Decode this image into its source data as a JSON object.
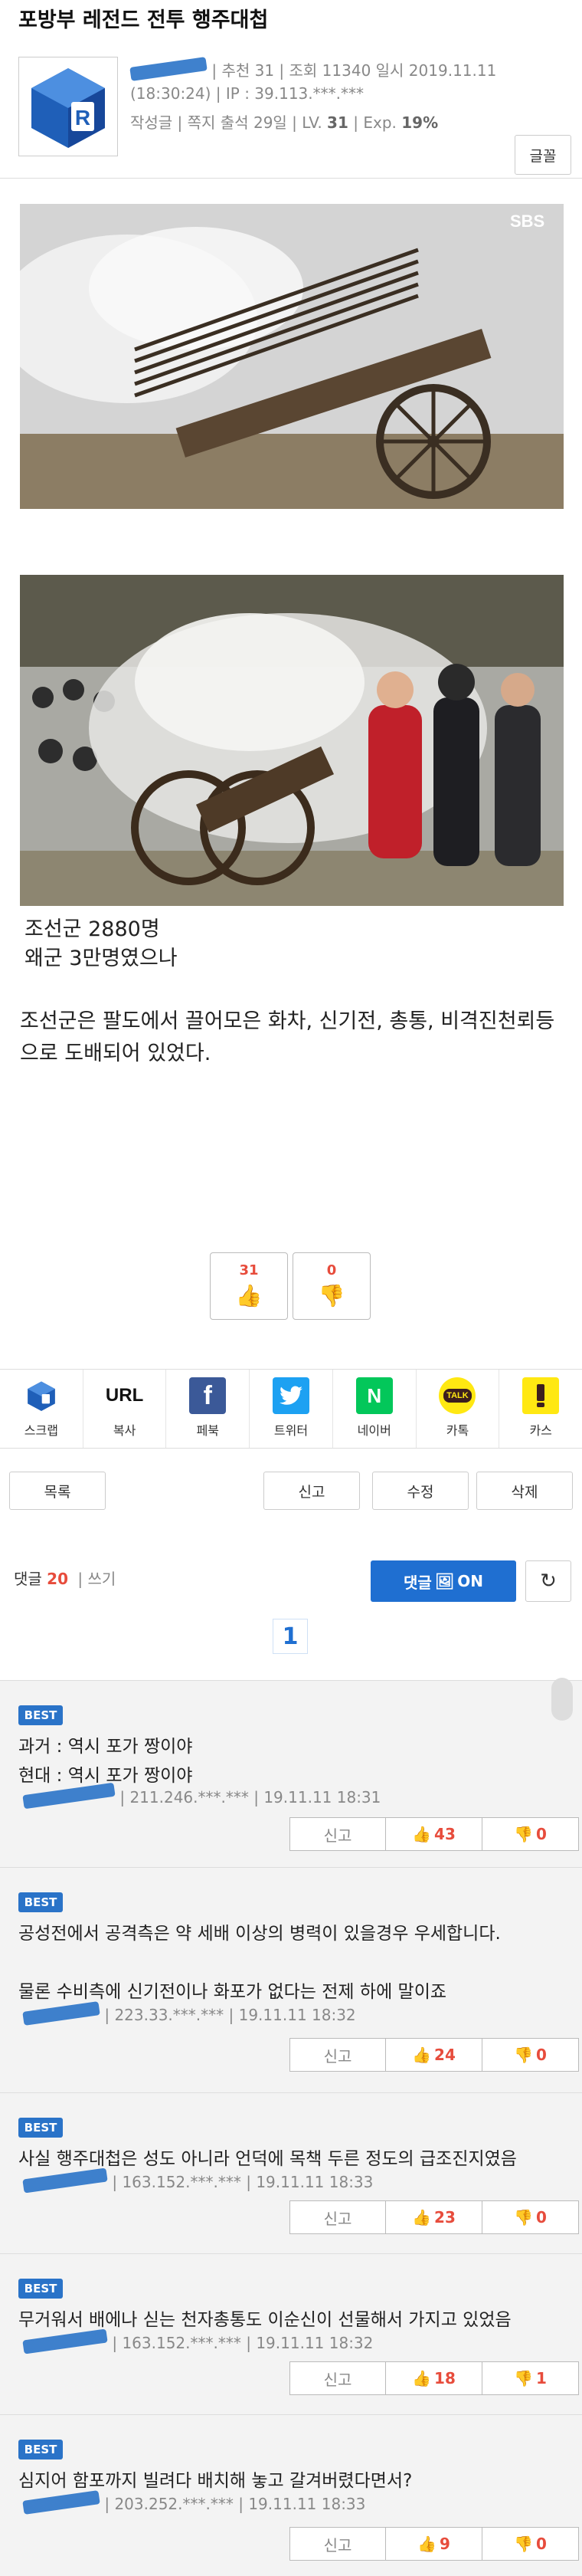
{
  "post": {
    "title": "포방부 레전드 전투 행주대첩",
    "meta_line1": "| 추천 31 | 조회 11340 일시 2019.11.11",
    "meta_line2": "(18:30:24) | IP : 39.113.***.***",
    "meta_line3_prefix": "작성글 | 쪽지 출석 29일 | LV.",
    "level": "31",
    "exp_label": "| Exp.",
    "exp_value": "19%",
    "font_button": "글꼴",
    "body_lines": [
      "조선군 2880명",
      "왜군 3만명였으나",
      "조선군은 팔도에서 끌어모은 화차, 신기전, 총통, 비격진천뢰등",
      "으로 도배되어 있었다."
    ],
    "votes": {
      "up": "31",
      "down": "0"
    }
  },
  "share": {
    "items": [
      {
        "label": "스크랩",
        "icon": "scrap-icon"
      },
      {
        "label": "복사",
        "icon": "url-icon",
        "icon_text": "URL"
      },
      {
        "label": "페북",
        "icon": "facebook-icon",
        "icon_text": "f"
      },
      {
        "label": "트위터",
        "icon": "twitter-icon"
      },
      {
        "label": "네이버",
        "icon": "naver-icon",
        "icon_text": "N"
      },
      {
        "label": "카톡",
        "icon": "kakaotalk-icon",
        "icon_text": "TALK"
      },
      {
        "label": "카스",
        "icon": "kakaostory-icon"
      }
    ]
  },
  "actions": {
    "list": "목록",
    "report": "신고",
    "edit": "수정",
    "delete": "삭제"
  },
  "comments_header": {
    "label": "댓글",
    "count": "20",
    "write": "| 쓰기",
    "on_label": "댓글",
    "on_state": "ON",
    "page": "1"
  },
  "comments": [
    {
      "badge": "BEST",
      "lines": [
        "과거 : 역시 포가 짱이야",
        "현대 : 역시 포가 짱이야"
      ],
      "meta": "| 211.246.***.*** | 19.11.11 18:31",
      "report": "신고",
      "up": "43",
      "down": "0"
    },
    {
      "badge": "BEST",
      "lines": [
        "공성전에서 공격측은 약 세배 이상의 병력이 있을경우 우세합니다.",
        "",
        "물론 수비측에 신기전이나 화포가 없다는 전제 하에 말이죠"
      ],
      "meta": "| 223.33.***.*** | 19.11.11 18:32",
      "report": "신고",
      "up": "24",
      "down": "0"
    },
    {
      "badge": "BEST",
      "lines": [
        "사실 행주대첩은 성도 아니라 언덕에 목책 두른 정도의 급조진지였음"
      ],
      "meta": "| 163.152.***.*** | 19.11.11 18:33",
      "report": "신고",
      "up": "23",
      "down": "0"
    },
    {
      "badge": "BEST",
      "lines": [
        "무거워서 배에나 싣는 천자총통도 이순신이 선물해서 가지고 있었음"
      ],
      "meta": "| 163.152.***.*** | 19.11.11 18:32",
      "report": "신고",
      "up": "18",
      "down": "1"
    },
    {
      "badge": "BEST",
      "lines": [
        "심지어 함포까지 빌려다 배치해 놓고 갈겨버렸다면서?"
      ],
      "meta": "| 203.252.***.*** | 19.11.11 18:33",
      "report": "신고",
      "up": "9",
      "down": "0"
    }
  ],
  "colors": {
    "accent": "#2a73c8",
    "button_blue": "#1f6fd1",
    "count_red": "#e74c3c",
    "facebook": "#3b5998",
    "twitter": "#1da1f2",
    "naver": "#03c75a",
    "kakao": "#ffe812"
  }
}
